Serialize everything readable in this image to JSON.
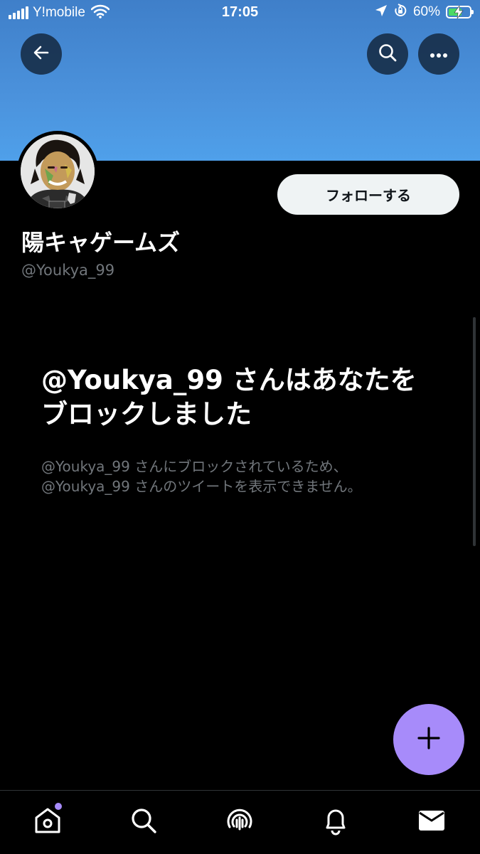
{
  "status_bar": {
    "carrier": "Y!mobile",
    "time": "17:05",
    "battery_percent": "60%",
    "battery_level": 0.6,
    "icons": [
      "signal-icon",
      "wifi-icon",
      "location-icon",
      "orientation-lock-icon",
      "battery-charging-icon"
    ]
  },
  "header": {
    "icons": [
      "back-arrow-icon",
      "search-icon",
      "more-icon"
    ]
  },
  "profile": {
    "display_name": "陽キャゲームズ",
    "handle": "@Youkya_99",
    "follow_label": "フォローする"
  },
  "blocked": {
    "title": "@Youkya_99 さんはあなたをブロックしました",
    "line1": "@Youkya_99 さんにブロックされているため、",
    "line2": "@Youkya_99 さんのツイートを表示できません。"
  },
  "fab": {
    "icon": "plus-icon"
  },
  "tab_bar": {
    "icons": [
      "home-icon",
      "search-icon",
      "spaces-icon",
      "bell-icon",
      "mail-icon"
    ],
    "accent_color": "#a78bfa"
  },
  "colors": {
    "background": "#000000",
    "banner": "#4b92dc",
    "secondary_text": "#71767b",
    "accent": "#a78bfa"
  }
}
